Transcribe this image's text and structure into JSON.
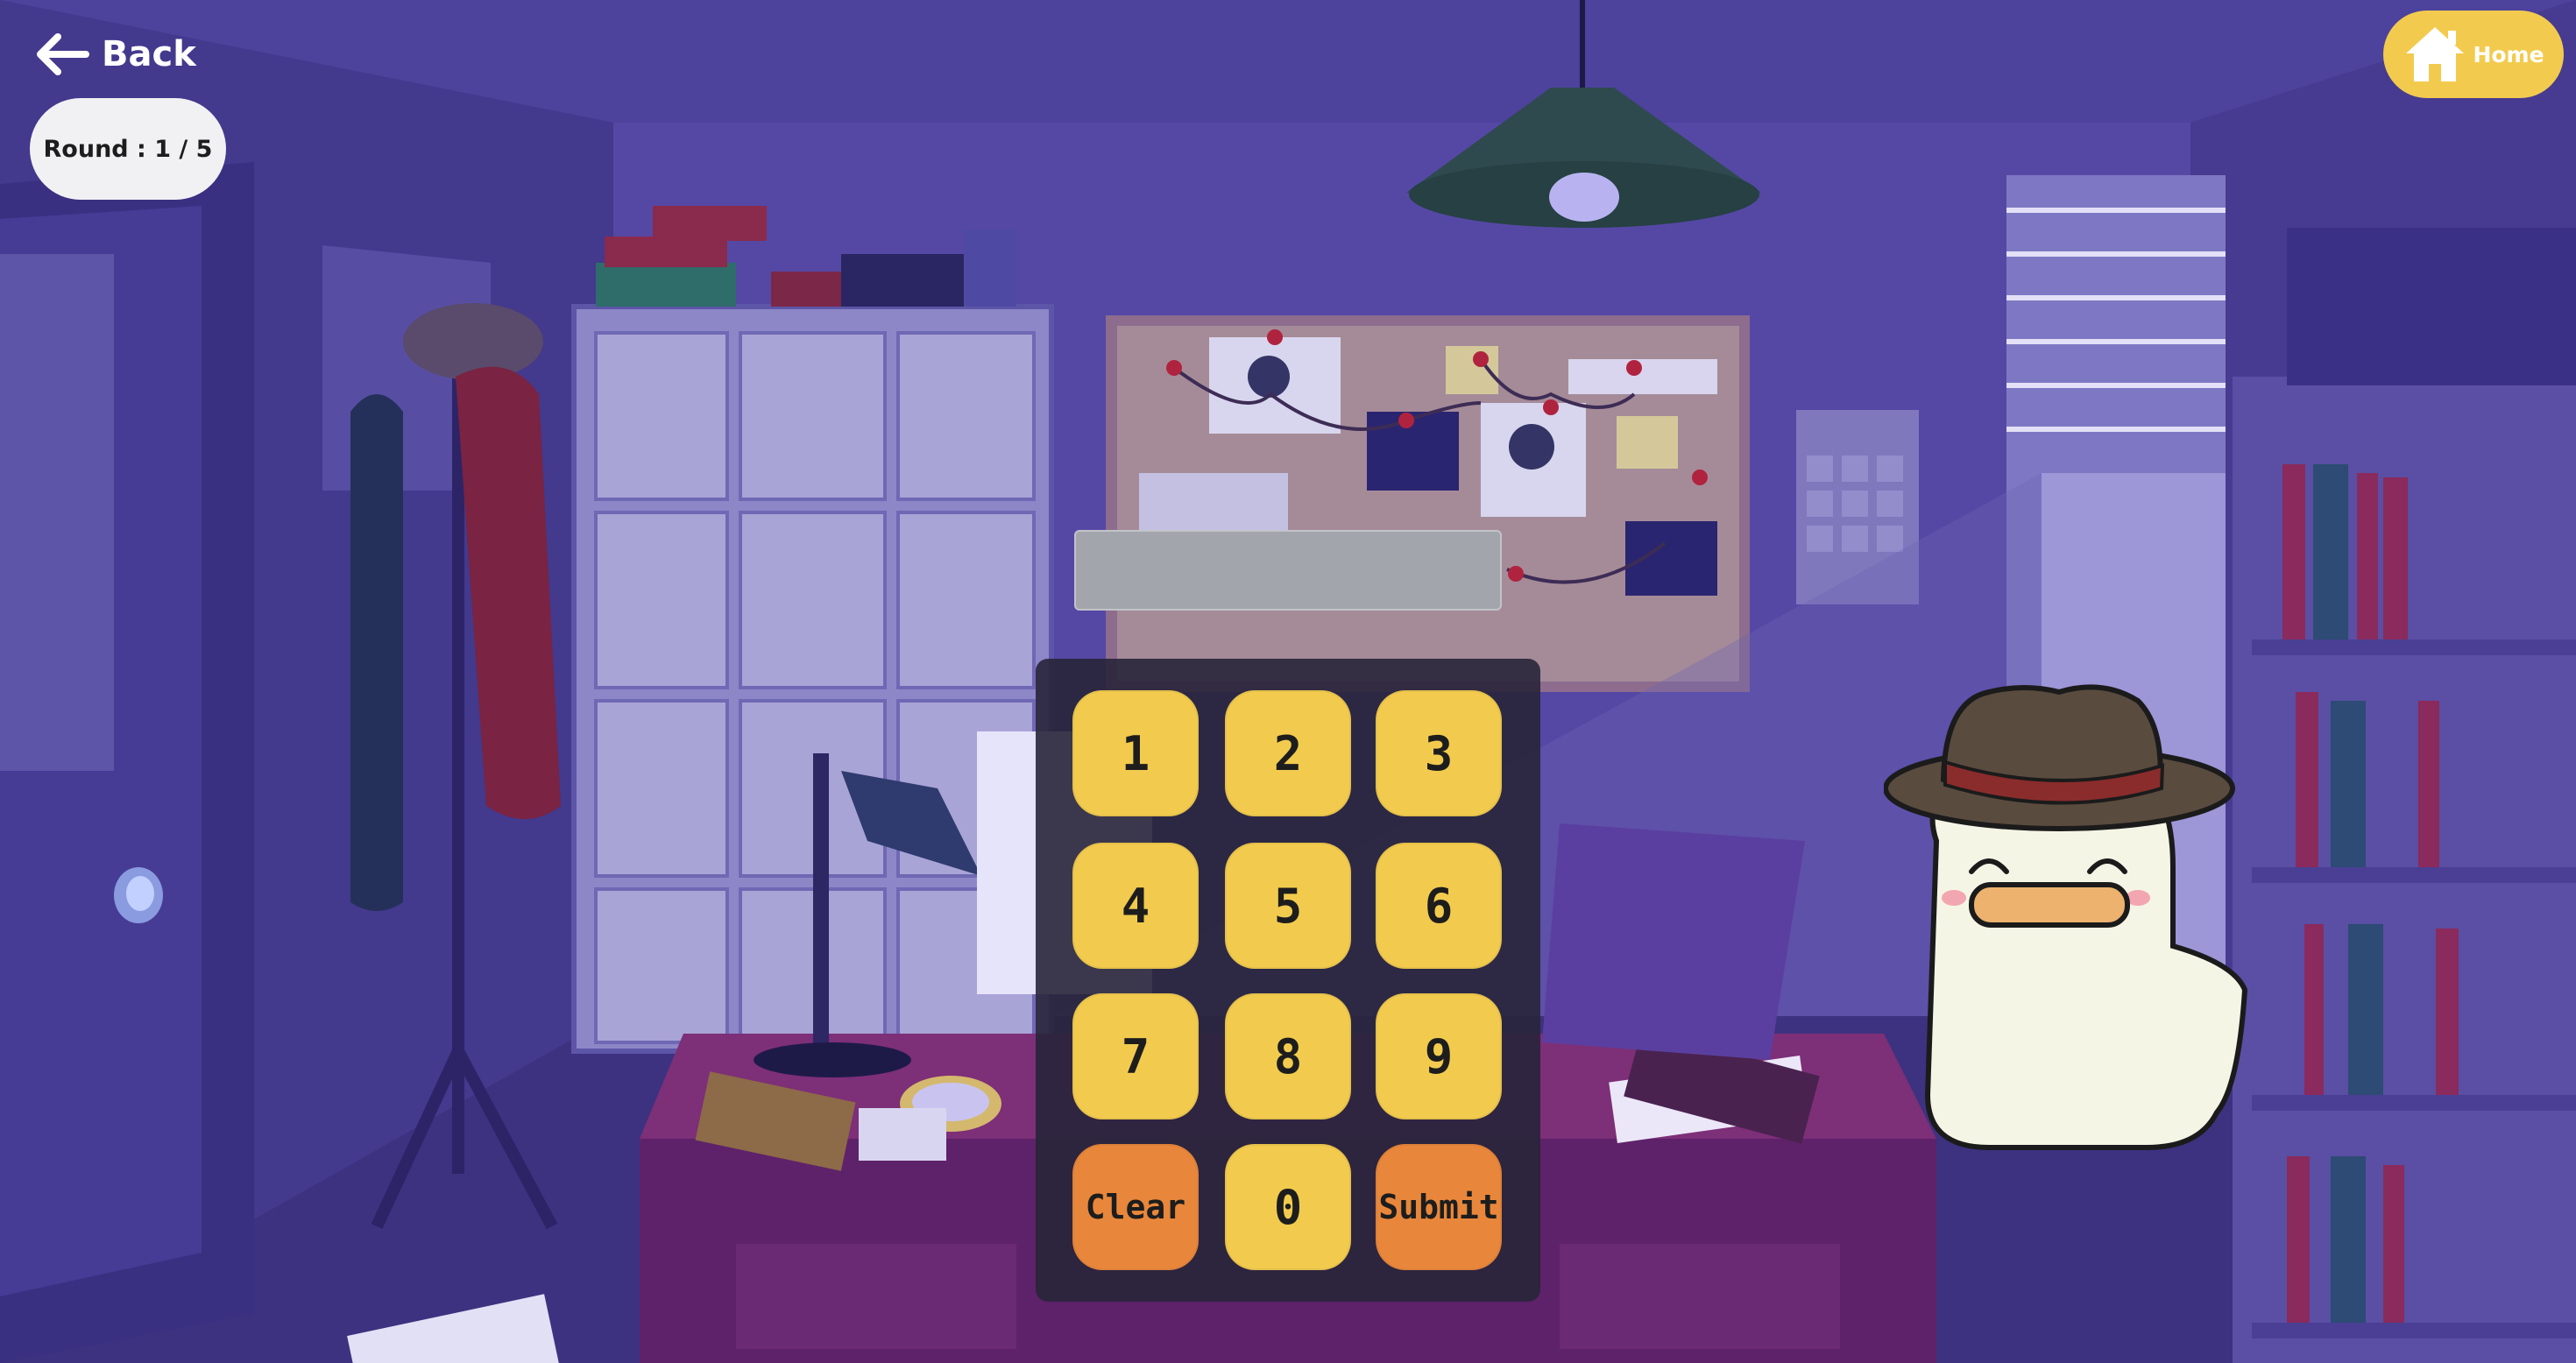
{
  "nav": {
    "back_label": "Back",
    "home_label": "Home"
  },
  "round": {
    "label": "Round : 1 / 5"
  },
  "input": {
    "value": ""
  },
  "keypad": {
    "keys": [
      "1",
      "2",
      "3",
      "4",
      "5",
      "6",
      "7",
      "8",
      "9",
      "Clear",
      "0",
      "Submit"
    ]
  },
  "colors": {
    "key_yellow": "#f2cb4e",
    "key_orange": "#e8873b",
    "badge_white": "#f1f1f4",
    "display_gray": "#a3a5ad"
  },
  "icons": [
    "back-arrow-icon",
    "home-icon",
    "detective-duck-character"
  ]
}
